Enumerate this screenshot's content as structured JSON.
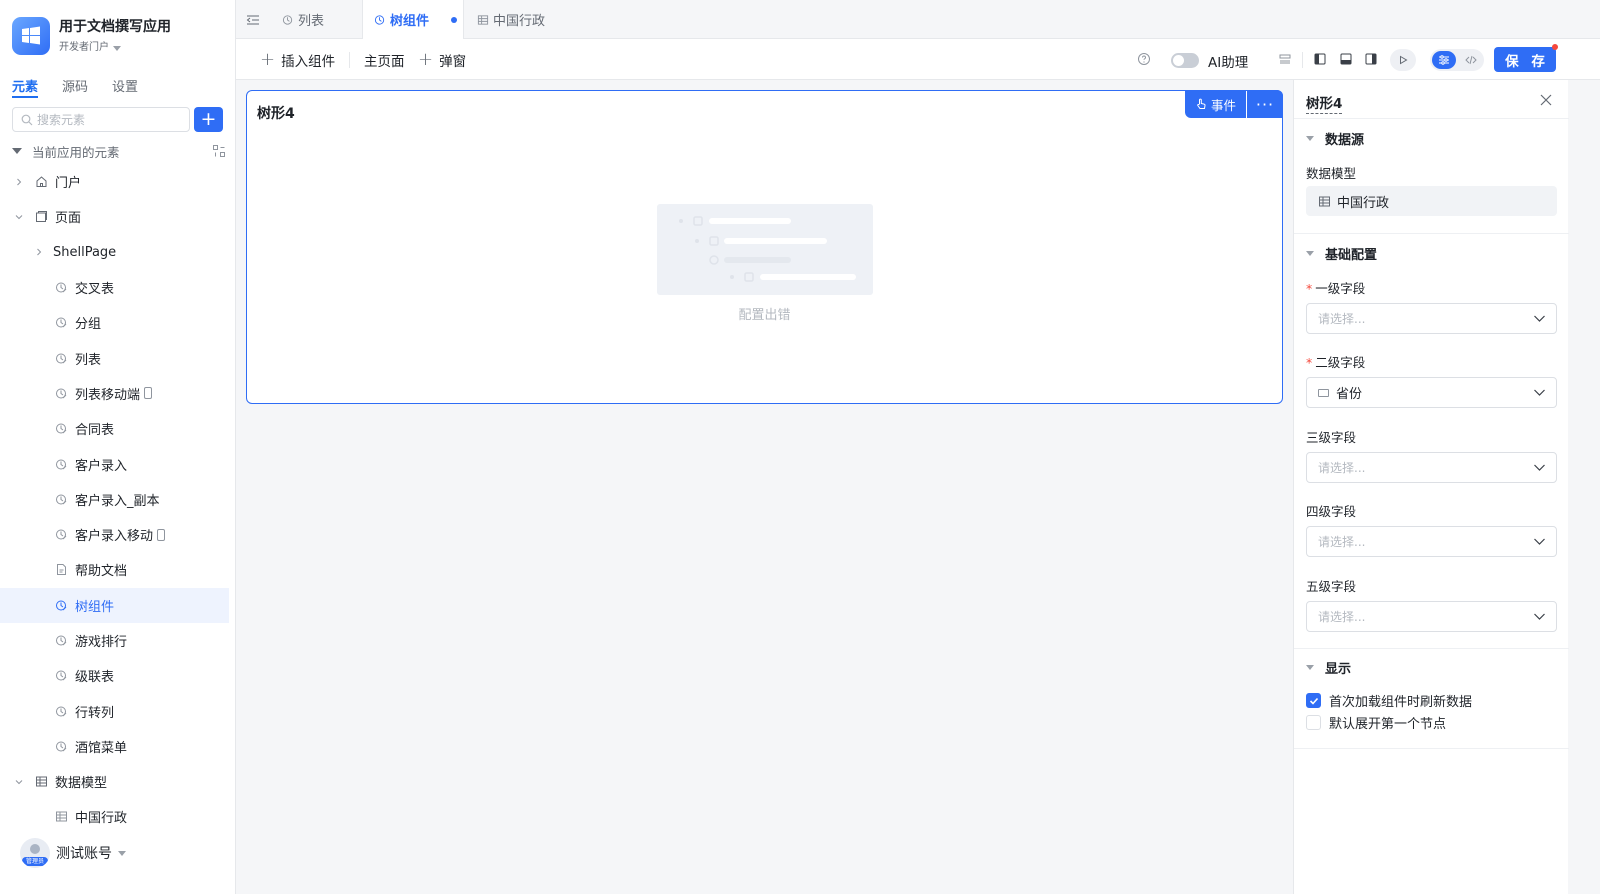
{
  "app": {
    "title": "用于文档撰写应用",
    "subtitle": "开发者门户"
  },
  "sidebar": {
    "tabs": [
      {
        "label": "元素"
      },
      {
        "label": "源码"
      },
      {
        "label": "设置"
      }
    ],
    "search_placeholder": "搜索元素",
    "add_label": "+",
    "section_title": "当前应用的元素",
    "tree": [
      {
        "label": "门户"
      },
      {
        "label": "页面"
      },
      {
        "label": "ShellPage"
      },
      {
        "label": "交叉表"
      },
      {
        "label": "分组"
      },
      {
        "label": "列表"
      },
      {
        "label": "列表移动端"
      },
      {
        "label": "合同表"
      },
      {
        "label": "客户录入"
      },
      {
        "label": "客户录入_副本"
      },
      {
        "label": "客户录入移动"
      },
      {
        "label": "帮助文档"
      },
      {
        "label": "树组件"
      },
      {
        "label": "游戏排行"
      },
      {
        "label": "级联表"
      },
      {
        "label": "行转列"
      },
      {
        "label": "酒馆菜单"
      },
      {
        "label": "数据模型"
      },
      {
        "label": "中国行政"
      }
    ],
    "user": {
      "name": "测试账号",
      "badge": "管理员"
    }
  },
  "tabs": [
    {
      "label": "列表"
    },
    {
      "label": "树组件"
    },
    {
      "label": "中国行政"
    }
  ],
  "toolbar": {
    "insert_label": "插入组件",
    "main_page_label": "主页面",
    "popup_label": "弹窗",
    "ai_label": "AI助理",
    "save_label": "保 存"
  },
  "canvas": {
    "title": "树形4",
    "event_label": "事件",
    "more_label": "···",
    "empty_text": "配置出错"
  },
  "panel": {
    "title": "树形4",
    "group_datasource": "数据源",
    "data_model_label": "数据模型",
    "data_model_value": "中国行政",
    "group_basic": "基础配置",
    "fields": [
      {
        "label": "一级字段",
        "required": true,
        "value": "",
        "placeholder": "请选择..."
      },
      {
        "label": "二级字段",
        "required": true,
        "value": "省份",
        "placeholder": ""
      },
      {
        "label": "三级字段",
        "required": false,
        "value": "",
        "placeholder": "请选择..."
      },
      {
        "label": "四级字段",
        "required": false,
        "value": "",
        "placeholder": "请选择..."
      },
      {
        "label": "五级字段",
        "required": false,
        "value": "",
        "placeholder": "请选择..."
      }
    ],
    "required_mark": "*",
    "group_display": "显示",
    "checkboxes": [
      {
        "label": "首次加载组件时刷新数据",
        "checked": true
      },
      {
        "label": "默认展开第一个节点",
        "checked": false
      }
    ]
  },
  "colors": {
    "accent": "#2f6df5",
    "required": "#f5483b"
  }
}
